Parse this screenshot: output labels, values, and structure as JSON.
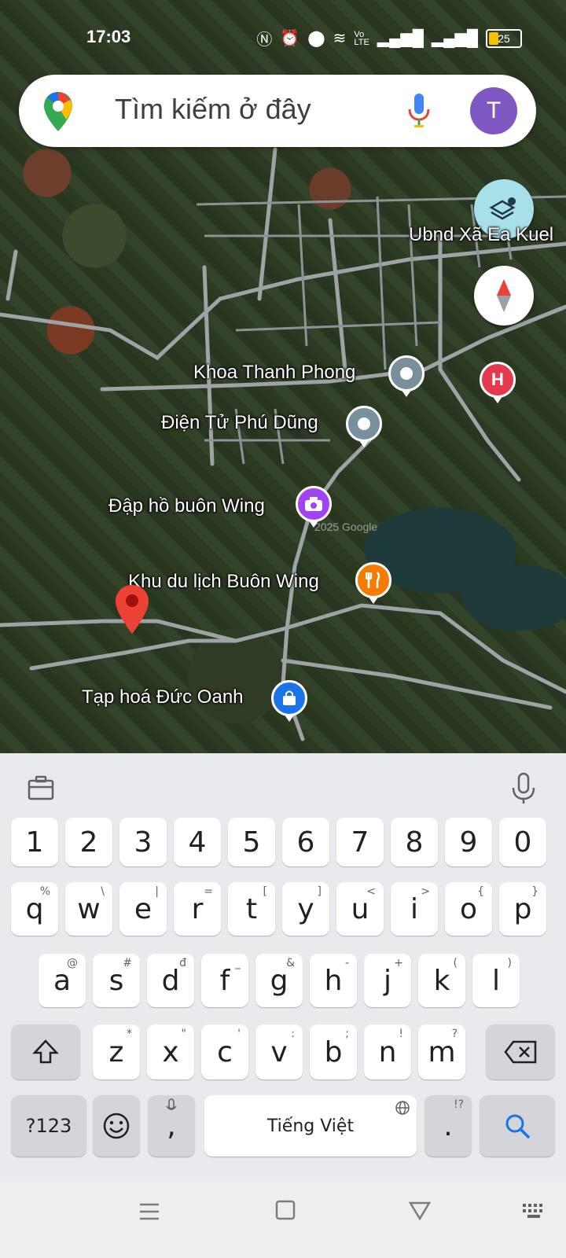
{
  "status_bar": {
    "time": "17:03",
    "battery": "25"
  },
  "search": {
    "placeholder": "Tìm kiếm ở đây",
    "avatar_letter": "T"
  },
  "map": {
    "labels": {
      "ubnd": "Ubnd Xã Ea Kuel",
      "khoa": "Khoa Thanh Phong",
      "dientu": "Điện Tử Phú Dũng",
      "dap": "Đập hồ buôn Wing",
      "khudulich": "Khu du lịch Buôn Wing",
      "taphoa": "Tạp hoá Đức Oanh"
    },
    "watermark": "2025 Google"
  },
  "keyboard": {
    "numbers": [
      "1",
      "2",
      "3",
      "4",
      "5",
      "6",
      "7",
      "8",
      "9",
      "0"
    ],
    "row1": [
      {
        "k": "q",
        "h": "%"
      },
      {
        "k": "w",
        "h": "\\"
      },
      {
        "k": "e",
        "h": "|"
      },
      {
        "k": "r",
        "h": "="
      },
      {
        "k": "t",
        "h": "["
      },
      {
        "k": "y",
        "h": "]"
      },
      {
        "k": "u",
        "h": "<"
      },
      {
        "k": "i",
        "h": ">"
      },
      {
        "k": "o",
        "h": "{"
      },
      {
        "k": "p",
        "h": "}"
      }
    ],
    "row2": [
      {
        "k": "a",
        "h": "@"
      },
      {
        "k": "s",
        "h": "#"
      },
      {
        "k": "d",
        "h": "đ"
      },
      {
        "k": "f",
        "h": "_"
      },
      {
        "k": "g",
        "h": "&"
      },
      {
        "k": "h",
        "h": "-"
      },
      {
        "k": "j",
        "h": "+"
      },
      {
        "k": "k",
        "h": "("
      },
      {
        "k": "l",
        "h": ")"
      }
    ],
    "row3": [
      {
        "k": "z",
        "h": "*"
      },
      {
        "k": "x",
        "h": "\""
      },
      {
        "k": "c",
        "h": "'"
      },
      {
        "k": "v",
        "h": ":"
      },
      {
        "k": "b",
        "h": ";"
      },
      {
        "k": "n",
        "h": "!"
      },
      {
        "k": "m",
        "h": "?"
      }
    ],
    "symbols_label": "?123",
    "comma": ",",
    "space_label": "Tiếng Việt",
    "period": ".",
    "period_hint": "!?"
  },
  "colors": {
    "accent_blue": "#1a73e8",
    "avatar": "#7e57c2",
    "hospital": "#e53950",
    "pin_red": "#ea4335"
  }
}
